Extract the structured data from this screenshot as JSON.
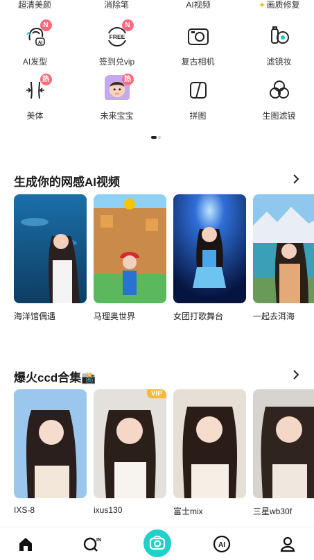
{
  "top_row": [
    "超清美颜",
    "消除笔",
    "AI视频",
    "画质修复"
  ],
  "tools": [
    {
      "label": "AI发型",
      "icon": "ai-hair-icon",
      "badge": "N"
    },
    {
      "label": "签到兑vip",
      "icon": "free-checkin-icon",
      "badge": "N"
    },
    {
      "label": "复古相机",
      "icon": "retro-camera-icon",
      "badge": ""
    },
    {
      "label": "滤镜妆",
      "icon": "filter-makeup-icon",
      "badge": ""
    },
    {
      "label": "美体",
      "icon": "body-slim-icon",
      "badge": "热"
    },
    {
      "label": "未来宝宝",
      "icon": "future-baby-icon",
      "badge": "热"
    },
    {
      "label": "拼图",
      "icon": "collage-icon",
      "badge": ""
    },
    {
      "label": "生图滤镜",
      "icon": "image-filter-icon",
      "badge": ""
    }
  ],
  "section1": {
    "title": "生成你的网感AI视频",
    "cards": [
      "海洋馆偶遇",
      "马理奥世界",
      "女团打歌舞台",
      "一起去洱海"
    ]
  },
  "section2": {
    "title": "爆火ccd合集📸",
    "cards": [
      "IXS-8",
      "ixus130",
      "富士mix",
      "三星wb30f"
    ],
    "vip_label": "VIP"
  },
  "tabbar": [
    "home-icon",
    "ins-search-icon",
    "camera-icon",
    "ai-icon",
    "profile-icon"
  ],
  "colors": {
    "accent": "#1fd1c9",
    "badge": "#ff6b7e",
    "vip": "#f5b942"
  }
}
